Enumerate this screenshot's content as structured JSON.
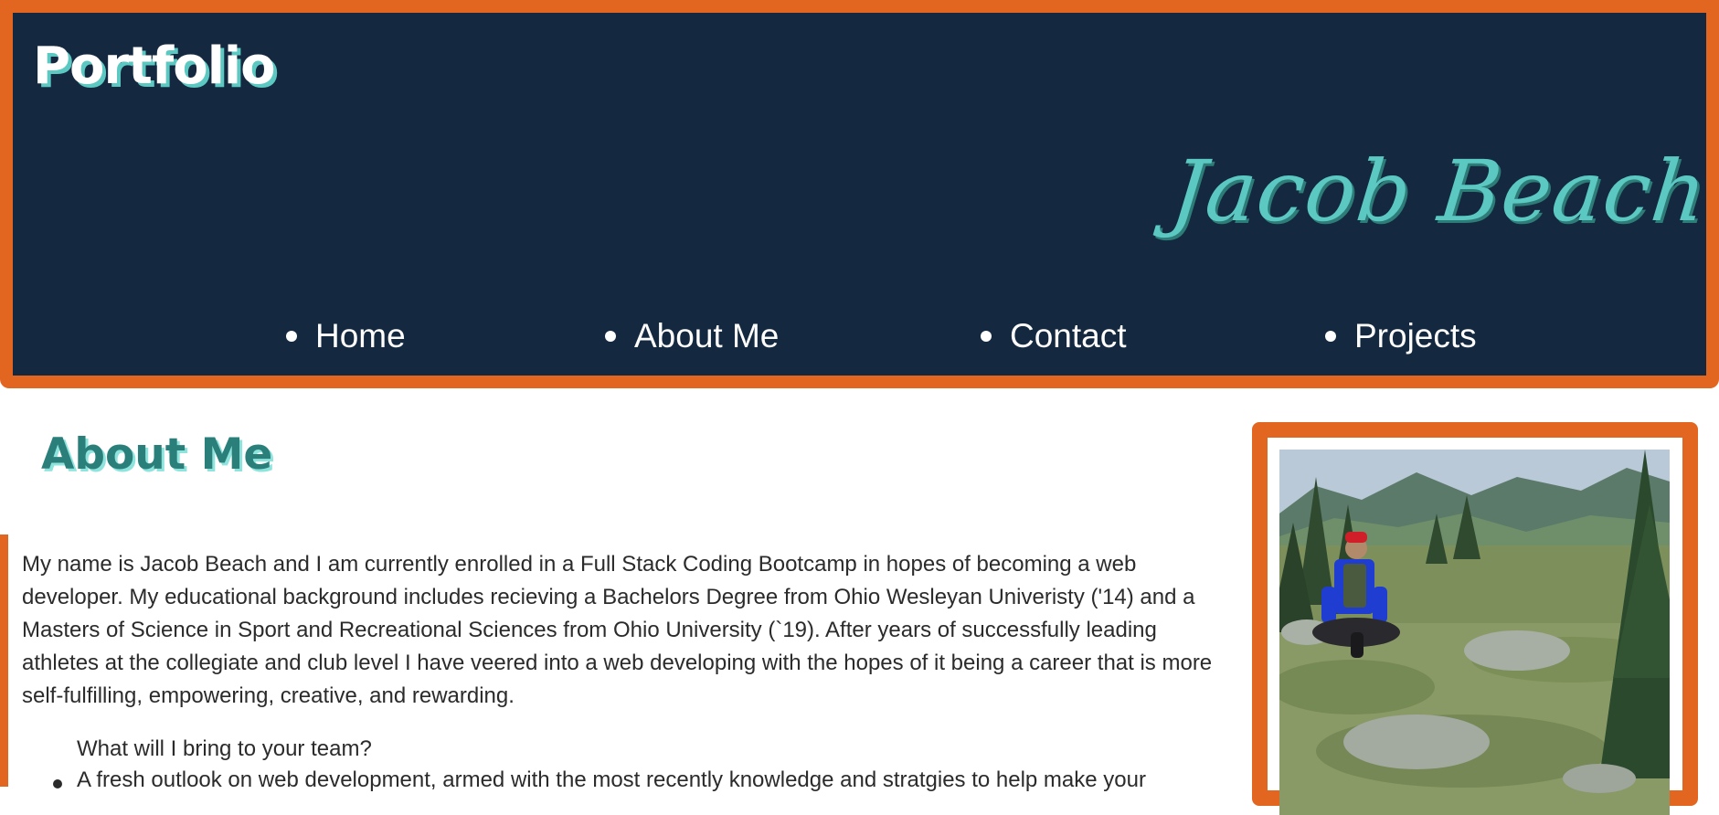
{
  "header": {
    "brand": "Portfolio",
    "name": "Jacob Beach"
  },
  "nav": [
    {
      "label": "Home"
    },
    {
      "label": "About Me"
    },
    {
      "label": "Contact"
    },
    {
      "label": "Projects"
    }
  ],
  "about": {
    "title": "About Me",
    "intro": "My name is Jacob Beach and I am currently enrolled in a Full Stack Coding Bootcamp in hopes of becoming a web developer. My educational background includes recieving a Bachelors Degree from Ohio Wesleyan Univeristy ('14) and a Masters of Science in Sport and Recreational Sciences from Ohio University (`19). After years of successfully leading athletes at the collegiate and club level I have veered into a web developing with the hopes of it being a career that is more self-fulfilling, empowering, creative, and rewarding.",
    "question": "What will I bring to your team?",
    "bullets": [
      "A fresh outlook on web development, armed with the most recently knowledge and stratgies to help make your"
    ]
  },
  "photo": {
    "icon": "profile-photo"
  },
  "colors": {
    "accent": "#e2661f",
    "header_bg": "#142940",
    "teal": "#5cc8c2",
    "text": "#2b2b2b"
  }
}
